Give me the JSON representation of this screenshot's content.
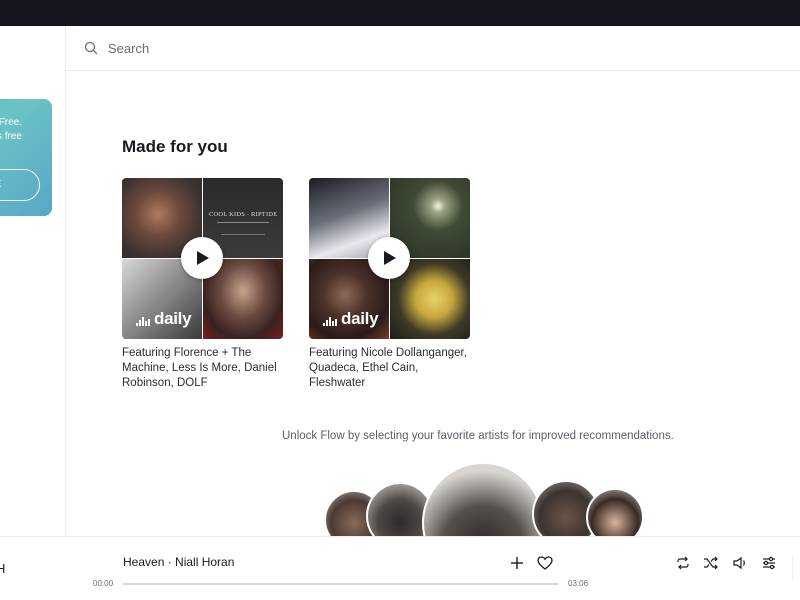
{
  "sidebar": {
    "promo": {
      "text": "Free.\nds free",
      "button_label": "E"
    },
    "fragment": "s"
  },
  "search": {
    "placeholder": "Search"
  },
  "main": {
    "section_title": "Made for you",
    "cards": [
      {
        "caption": "Featuring Florence + The Machine, Less Is More, Daniel Robinson, DOLF",
        "logo": "daily",
        "art_text": "COOL KIDS · RIPTIDE"
      },
      {
        "caption": "Featuring Nicole Dollanganger, Quadeca, Ethel Cain, Fleshwater",
        "logo": "daily"
      }
    ],
    "unlock_text": "Unlock Flow by selecting your favorite artists for improved recommendations."
  },
  "player": {
    "left_fragment": "H",
    "track": "Heaven · Niall Horan",
    "elapsed": "00:00",
    "duration": "03:06",
    "progress": 0.0,
    "icons": [
      "plus-icon",
      "heart-icon",
      "repeat-icon",
      "shuffle-icon",
      "volume-icon",
      "equalizer-icon"
    ]
  },
  "colors": {
    "topbar": "#17151f",
    "promo_gradient": [
      "#39b5a9",
      "#58a6c8"
    ]
  }
}
